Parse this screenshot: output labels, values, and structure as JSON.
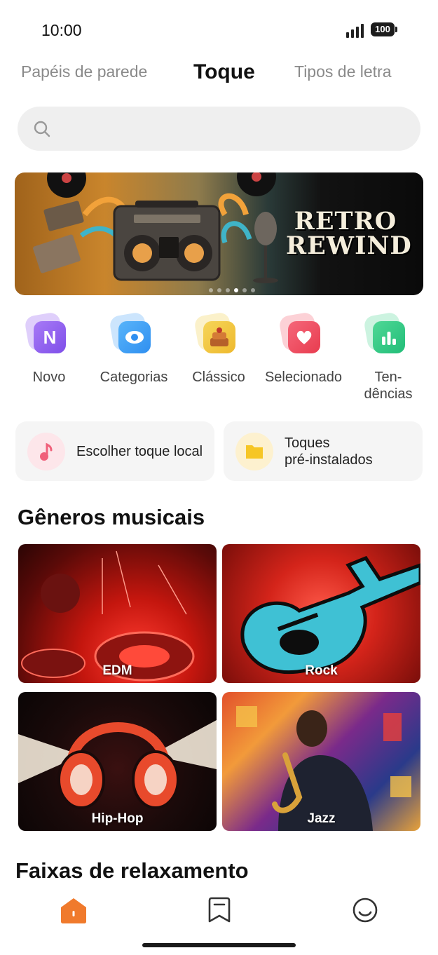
{
  "status_bar": {
    "time": "10:00",
    "battery": "100"
  },
  "top_tabs": [
    {
      "label": "Papéis de parede",
      "active": false
    },
    {
      "label": "Toque",
      "active": true
    },
    {
      "label": "Tipos de letra",
      "active": false
    }
  ],
  "search": {
    "placeholder": "",
    "icon": "search-icon"
  },
  "banner": {
    "title_line1": "RETRO",
    "title_line2": "REWIND",
    "page_count": 6,
    "active_page": 4
  },
  "quick_actions": [
    {
      "label": "Novo",
      "icon": "new-icon",
      "color": "#8f5bf2"
    },
    {
      "label": "Categorias",
      "icon": "eye-icon",
      "color": "#3e9ef5"
    },
    {
      "label": "Clássico",
      "icon": "cake-icon",
      "color": "#f1c43d"
    },
    {
      "label": "Selecionado",
      "icon": "heart-icon",
      "color": "#ef4a5c"
    },
    {
      "label": "Ten-",
      "label2": "dências",
      "icon": "chart-icon",
      "color": "#2fc984"
    }
  ],
  "cards": {
    "local": {
      "label": "Escolher toque local",
      "icon": "music-note-icon"
    },
    "preinstalled": {
      "label_line1": "Toques",
      "label_line2": "pré-instalados",
      "icon": "folder-icon"
    }
  },
  "sections": {
    "genres_title": "Gêneros musicais",
    "relax_title": "Faixas de relaxamento"
  },
  "genres": [
    {
      "label": "EDM"
    },
    {
      "label": "Rock"
    },
    {
      "label": "Hip-Hop"
    },
    {
      "label": "Jazz"
    }
  ],
  "bottom_nav": [
    {
      "icon": "home-icon",
      "active": true
    },
    {
      "icon": "bookmark-icon",
      "active": false
    },
    {
      "icon": "profile-icon",
      "active": false
    }
  ],
  "colors": {
    "accent": "#f07a2c"
  }
}
